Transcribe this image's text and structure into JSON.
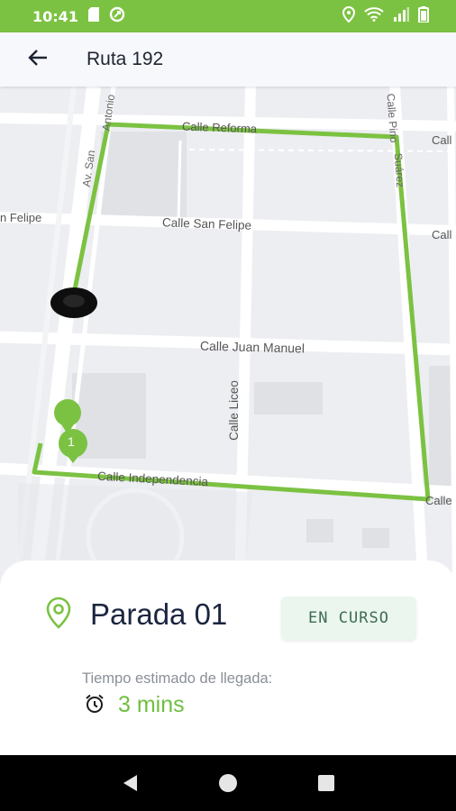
{
  "status_bar": {
    "time": "10:41",
    "icons_left": [
      "sd-card-icon",
      "data-saver-icon"
    ],
    "icons_right": [
      "location-icon",
      "wifi-icon",
      "signal-icon",
      "battery-icon"
    ],
    "color": "#7cc242"
  },
  "app_bar": {
    "title": "Ruta 192",
    "back_icon": "arrow-back-icon"
  },
  "map": {
    "streets": {
      "calle_reforma": "Calle Reforma",
      "calle_reforma_right": "Call",
      "calle_san_felipe": "Calle San Felipe",
      "san_felipe_left": "n Felipe",
      "calle_san_felipe_right": "Call",
      "calle_juan_manuel": "Calle Juan Manuel",
      "calle_liceo": "Calle Liceo",
      "calle_independencia": "Calle Independencia",
      "calle_independencia_right": "Calle",
      "antonio": "Antonio",
      "av_left": "Av. San",
      "calle_pino": "Calle Pino",
      "suarez": "Suárez"
    },
    "route_color": "#7cc242",
    "stop_marker_label": "1"
  },
  "stop_card": {
    "name": "Parada 01",
    "status": "EN CURSO",
    "eta_label": "Tiempo estimado de llegada:",
    "eta_value": "3 mins",
    "accent": "#6fbf3f"
  },
  "nav_bar": {
    "buttons": [
      "back-triangle-icon",
      "home-circle-icon",
      "recents-square-icon"
    ]
  }
}
